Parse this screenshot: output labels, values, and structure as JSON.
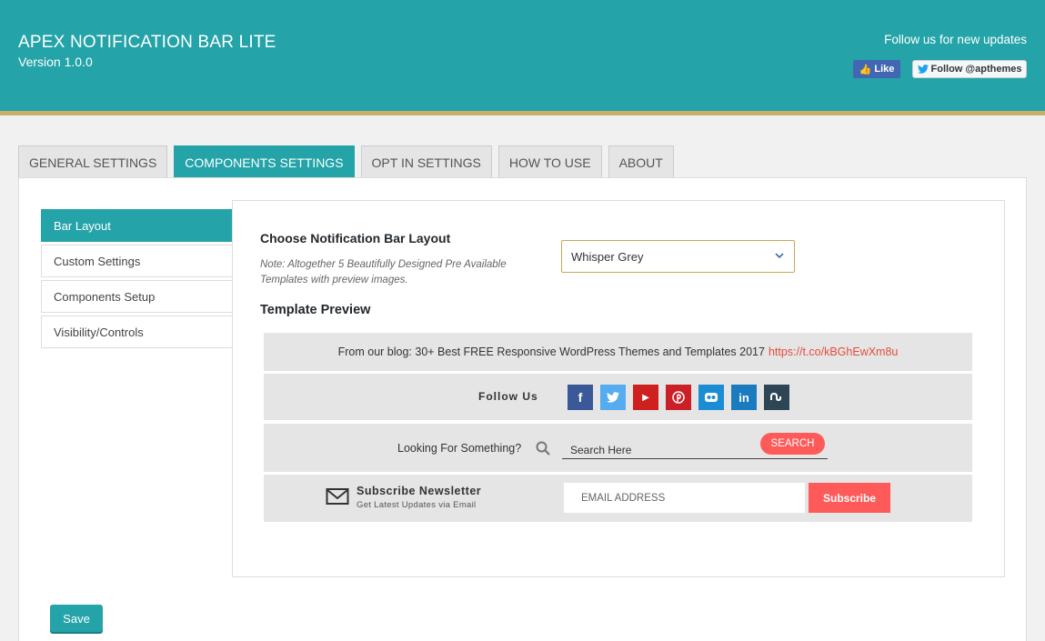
{
  "header": {
    "title": "APEX NOTIFICATION BAR LITE",
    "version": "Version 1.0.0",
    "follow_text": "Follow us for new updates",
    "like_label": "Like",
    "twitter_label": "Follow @apthemes"
  },
  "tabs": [
    {
      "label": "GENERAL SETTINGS",
      "active": false
    },
    {
      "label": "COMPONENTS SETTINGS",
      "active": true
    },
    {
      "label": "OPT IN SETTINGS",
      "active": false
    },
    {
      "label": "HOW TO USE",
      "active": false
    },
    {
      "label": "ABOUT",
      "active": false
    }
  ],
  "sidebar": {
    "items": [
      {
        "label": "Bar Layout",
        "active": true
      },
      {
        "label": "Custom Settings",
        "active": false
      },
      {
        "label": "Components Setup",
        "active": false
      },
      {
        "label": "Visibility/Controls",
        "active": false
      }
    ]
  },
  "layout_field": {
    "label": "Choose Notification Bar Layout",
    "note": "Note: Altogether 5 Beautifully Designed Pre Available Templates with preview images.",
    "selected": "Whisper Grey"
  },
  "preview": {
    "title": "Template Preview",
    "blog_text": "From our blog: 30+ Best FREE Responsive WordPress Themes and Templates 2017",
    "blog_link": "https://t.co/kBGhEwXm8u",
    "follow_label": "Follow Us",
    "social": [
      {
        "name": "facebook-icon",
        "glyph": "f",
        "color": "#3b5998"
      },
      {
        "name": "twitter-icon",
        "glyph": "t",
        "color": "#55acee"
      },
      {
        "name": "youtube-icon",
        "glyph": "▶",
        "color": "#cd201f"
      },
      {
        "name": "pinterest-icon",
        "glyph": "p",
        "color": "#cb2027"
      },
      {
        "name": "flickr-icon",
        "glyph": "●●",
        "color": "#1b8dd4"
      },
      {
        "name": "linkedin-icon",
        "glyph": "in",
        "color": "#1a7bbf"
      },
      {
        "name": "stumbleupon-icon",
        "glyph": "su",
        "color": "#2e4555"
      }
    ],
    "search_label": "Looking For Something?",
    "search_placeholder": "Search Here",
    "search_button": "SEARCH",
    "subscribe_title": "Subscribe Newsletter",
    "subscribe_sub": "Get Latest Updates via Email",
    "email_placeholder": "EMAIL ADDRESS",
    "subscribe_button": "Subscribe"
  },
  "save_label": "Save",
  "colors": {
    "accent": "#24a3a8",
    "header_border": "#c8b06a",
    "cta": "#ff5a5a"
  }
}
